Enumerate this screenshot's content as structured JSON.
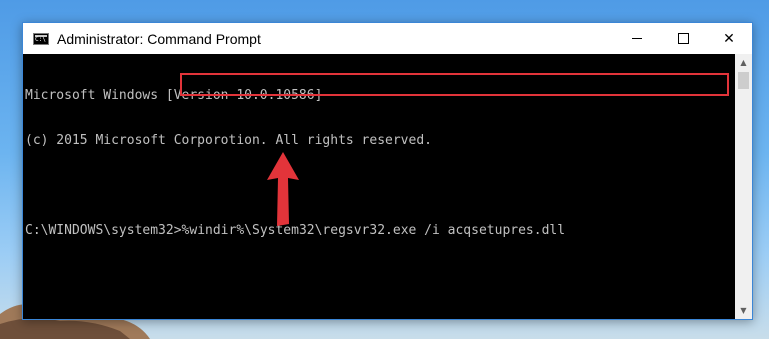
{
  "window": {
    "title": "Administrator: Command Prompt",
    "controls": {
      "minimize": "minimize",
      "maximize": "maximize",
      "close": "✕"
    }
  },
  "console": {
    "lines": [
      "Microsoft Windows [Version 10.0.10586]",
      "(c) 2015 Microsoft Corporotion. All rights reserved.",
      ""
    ],
    "prompt": "C:\\WINDOWS\\system32>",
    "command": "%windir%\\System32\\regsvr32.exe /i acqsetupres.dll"
  },
  "annotation": {
    "highlight_color": "#e2343a",
    "arrow_color": "#e2343a"
  },
  "icons": {
    "app": "command-prompt-icon",
    "arrow": "up-arrow-icon",
    "scroll_up": "scroll-up-arrow-icon",
    "scroll_down": "scroll-down-arrow-icon"
  }
}
